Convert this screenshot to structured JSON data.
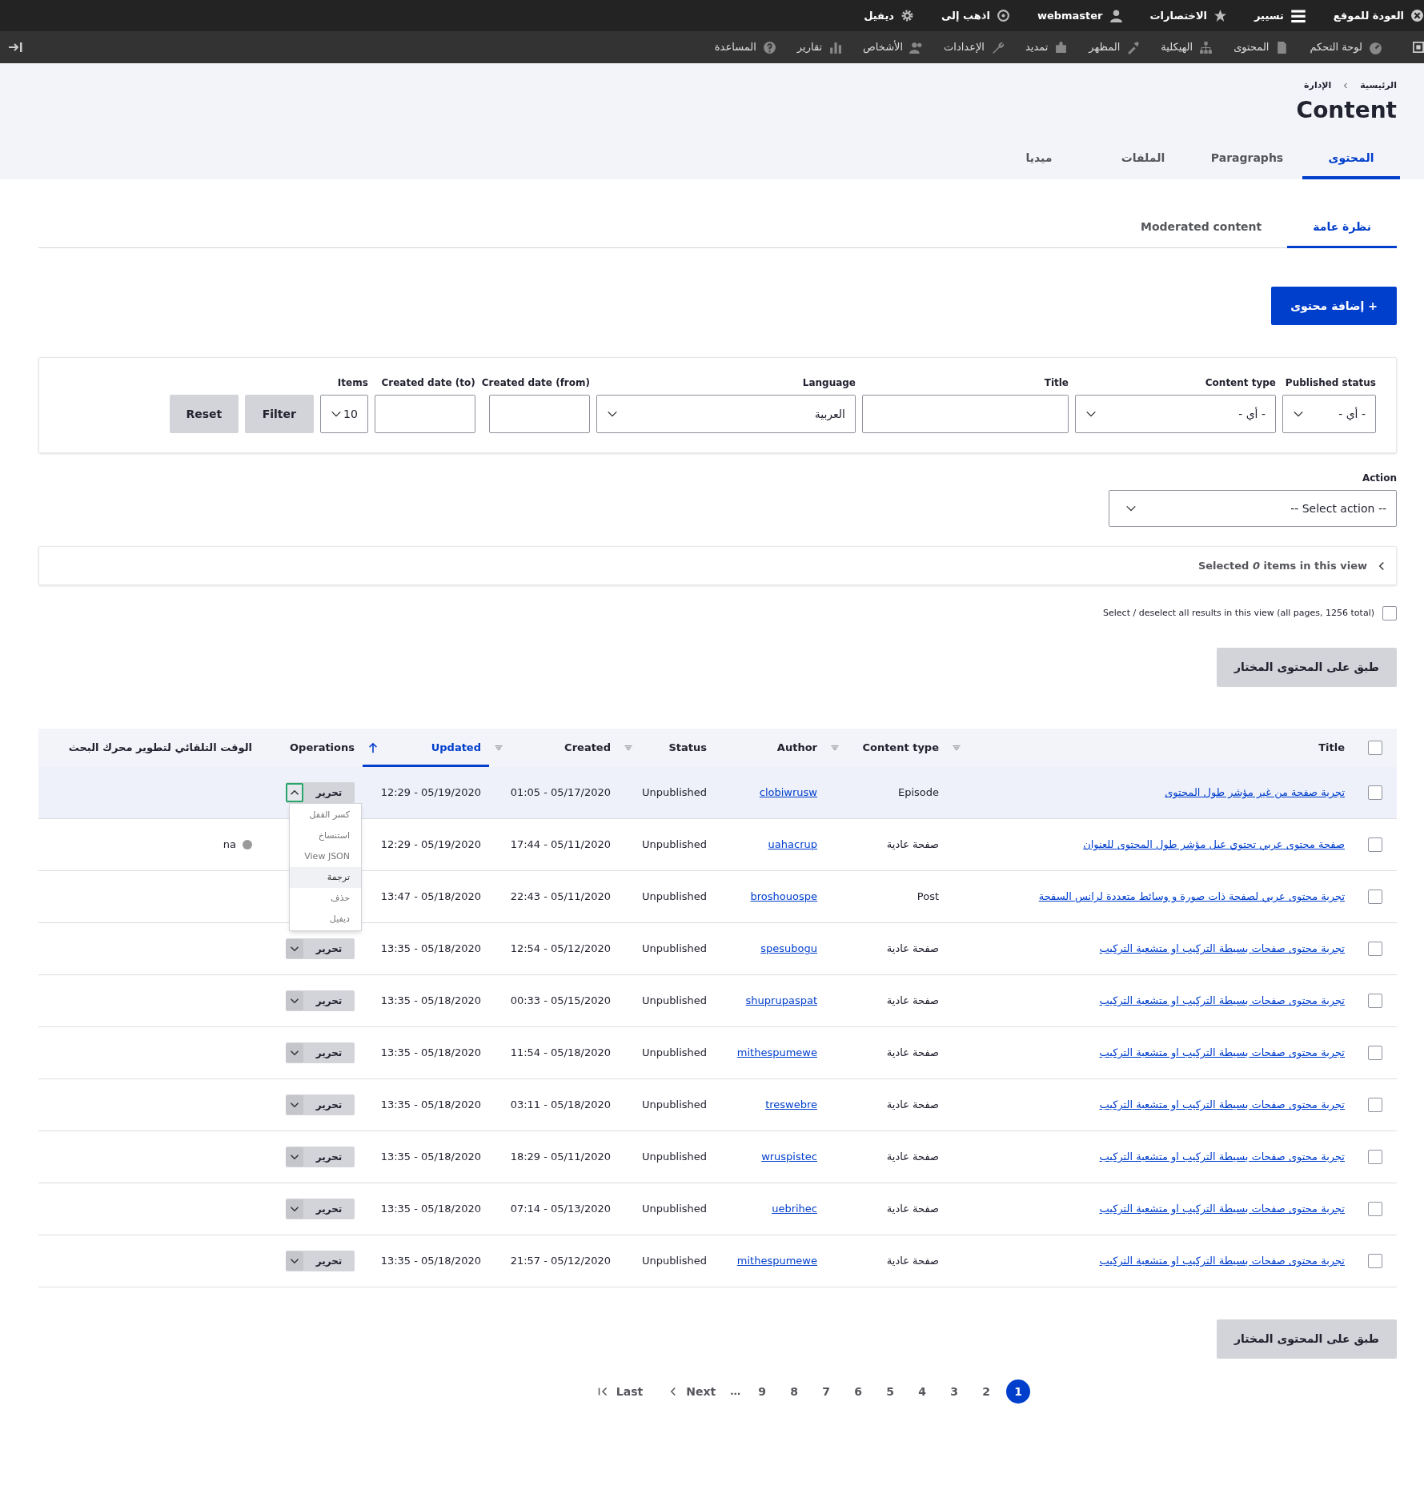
{
  "toolbar": {
    "tray": [
      {
        "label": "العودة للموقع"
      },
      {
        "label": "تسيير"
      },
      {
        "label": "الاختصارات"
      },
      {
        "label": "webmaster"
      },
      {
        "label": "اذهب إلى"
      },
      {
        "label": "ديفيل"
      }
    ],
    "menu": [
      "لوحة التحكم",
      "المحتوى",
      "الهيكلية",
      "المظهر",
      "تمديد",
      "الإعدادات",
      "الأشخاص",
      "تقارير",
      "المساعدة"
    ]
  },
  "breadcrumb": [
    "الرئيسية",
    "الإدارة"
  ],
  "page_title": "Content",
  "primary_tabs": [
    {
      "label": "المحتوى",
      "selected": true
    },
    {
      "label": "Paragraphs",
      "selected": false
    },
    {
      "label": "الملفات",
      "selected": false
    },
    {
      "label": "ميديا",
      "selected": false
    }
  ],
  "secondary_tabs": [
    {
      "label": "نظرة عامة",
      "selected": true
    },
    {
      "label": "Moderated content",
      "selected": false
    }
  ],
  "add_button": "+ إضافة محتوى",
  "filters": [
    {
      "kind": "select",
      "label": "Published status",
      "value": "- أي -"
    },
    {
      "kind": "select",
      "label": "Content type",
      "value": "- أي -"
    },
    {
      "kind": "text",
      "label": "Title"
    },
    {
      "kind": "select",
      "label": "Language",
      "value": "العربية"
    },
    {
      "kind": "text",
      "label": "Created date (from)"
    },
    {
      "kind": "text",
      "label": "Created date (to)"
    },
    {
      "kind": "select",
      "label": "Items",
      "value": "10"
    }
  ],
  "filter_buttons": [
    "Filter",
    "Reset"
  ],
  "action": {
    "label": "Action",
    "value": "-- Select action --"
  },
  "selection_summary": "Selected *0* items in this view",
  "select_all": {
    "label": "Select / deselect all results in this view (all pages, 1256 total)",
    "checked": false
  },
  "apply_button_top": "طبق على المحتوى المختار",
  "table": {
    "header_checked": false,
    "columns": [
      {
        "label": "Title",
        "sortable": true,
        "sorted": false
      },
      {
        "label": "Content type",
        "sortable": true,
        "sorted": false
      },
      {
        "label": "Author",
        "sortable": false,
        "sorted": false
      },
      {
        "label": "Status",
        "sortable": true,
        "sorted": false
      },
      {
        "label": "Created",
        "sortable": true,
        "sorted": false
      },
      {
        "label": "Updated",
        "sortable": true,
        "sorted": true
      },
      {
        "label": "Operations",
        "sortable": false,
        "sorted": false
      },
      {
        "label": "الوقت التلقائي لتطوير محرك البحث",
        "sortable": false,
        "sorted": false
      }
    ],
    "rows": [
      {
        "checked": false,
        "highlighted": true,
        "title": "تجربة صفحة من غير مؤشر طول المحتوى",
        "content_type": "Episode",
        "author": "clobiwrusw",
        "status": "Unpublished",
        "created": "01:05 - 05/17/2020",
        "updated": "12:29 - 05/19/2020",
        "edit": "تحرير",
        "menu_open": true,
        "menu": [
          {
            "label": "كسر القفل",
            "highlighted": false
          },
          {
            "label": "استنساخ",
            "highlighted": false
          },
          {
            "label": "View JSON",
            "highlighted": false
          },
          {
            "label": "ترجمة",
            "highlighted": true
          },
          {
            "label": "حذف",
            "highlighted": false
          },
          {
            "label": "ديفيل",
            "highlighted": false
          }
        ]
      },
      {
        "checked": false,
        "highlighted": false,
        "title": "صفحة محتوى عربي تحتوي عىل مؤشر طول المحتوى للعنوان",
        "content_type": "صفحة عادية",
        "author": "uahacrup",
        "status": "Unpublished",
        "created": "17:44 - 05/11/2020",
        "updated": "12:29 - 05/19/2020",
        "note": "na"
      },
      {
        "checked": false,
        "highlighted": false,
        "title": "تجربة محتوى عربي لصفحة ذات صورة و وسائط متعددة لرانس السفحة",
        "content_type": "Post",
        "author": "broshouospe",
        "status": "Unpublished",
        "created": "22:43 - 05/11/2020",
        "updated": "13:47 - 05/18/2020"
      },
      {
        "checked": false,
        "highlighted": false,
        "title": "تجربة محتوى صفحات بسيطة التركيب او متشعبة التركيب",
        "content_type": "صفحة عادية",
        "author": "spesubogu",
        "status": "Unpublished",
        "created": "12:54 - 05/12/2020",
        "updated": "13:35 - 05/18/2020",
        "edit": "تحرير",
        "menu_open": false
      },
      {
        "checked": false,
        "highlighted": false,
        "title": "تجربة محتوى صفحات بسيطة التركيب او متشعبة التركيب",
        "content_type": "صفحة عادية",
        "author": "shuprupaspat",
        "status": "Unpublished",
        "created": "00:33 - 05/15/2020",
        "updated": "13:35 - 05/18/2020",
        "edit": "تحرير",
        "menu_open": false
      },
      {
        "checked": false,
        "highlighted": false,
        "title": "تجربة محتوى صفحات بسيطة التركيب او متشعبة التركيب",
        "content_type": "صفحة عادية",
        "author": "mithespumewe",
        "status": "Unpublished",
        "created": "11:54 - 05/18/2020",
        "updated": "13:35 - 05/18/2020",
        "edit": "تحرير",
        "menu_open": false
      },
      {
        "checked": false,
        "highlighted": false,
        "title": "تجربة محتوى صفحات بسيطة التركيب او متشعبة التركيب",
        "content_type": "صفحة عادية",
        "author": "treswebre",
        "status": "Unpublished",
        "created": "03:11 - 05/18/2020",
        "updated": "13:35 - 05/18/2020",
        "edit": "تحرير",
        "menu_open": false
      },
      {
        "checked": false,
        "highlighted": false,
        "title": "تجربة محتوى صفحات بسيطة التركيب او متشعبة التركيب",
        "content_type": "صفحة عادية",
        "author": "wruspistec",
        "status": "Unpublished",
        "created": "18:29 - 05/11/2020",
        "updated": "13:35 - 05/18/2020",
        "edit": "تحرير",
        "menu_open": false
      },
      {
        "checked": false,
        "highlighted": false,
        "title": "تجربة محتوى صفحات بسيطة التركيب او متشعبة التركيب",
        "content_type": "صفحة عادية",
        "author": "uebrihec",
        "status": "Unpublished",
        "created": "07:14 - 05/13/2020",
        "updated": "13:35 - 05/18/2020",
        "edit": "تحرير",
        "menu_open": false
      },
      {
        "checked": false,
        "highlighted": false,
        "title": "تجربة محتوى صفحات بسيطة التركيب او متشعبة التركيب",
        "content_type": "صفحة عادية",
        "author": "mithespumewe",
        "status": "Unpublished",
        "created": "21:57 - 05/12/2020",
        "updated": "13:35 - 05/18/2020",
        "edit": "تحرير",
        "menu_open": false
      }
    ]
  },
  "apply_button_bottom": "طبق على المحتوى المختار",
  "pagination": {
    "pages": [
      {
        "label": "1",
        "selected": true
      },
      {
        "label": "2",
        "selected": false
      },
      {
        "label": "3",
        "selected": false
      },
      {
        "label": "4",
        "selected": false
      },
      {
        "label": "5",
        "selected": false
      },
      {
        "label": "6",
        "selected": false
      },
      {
        "label": "7",
        "selected": false
      },
      {
        "label": "8",
        "selected": false
      },
      {
        "label": "9",
        "selected": false
      }
    ],
    "ellipsis": "…",
    "next": "Next",
    "last": "Last"
  }
}
